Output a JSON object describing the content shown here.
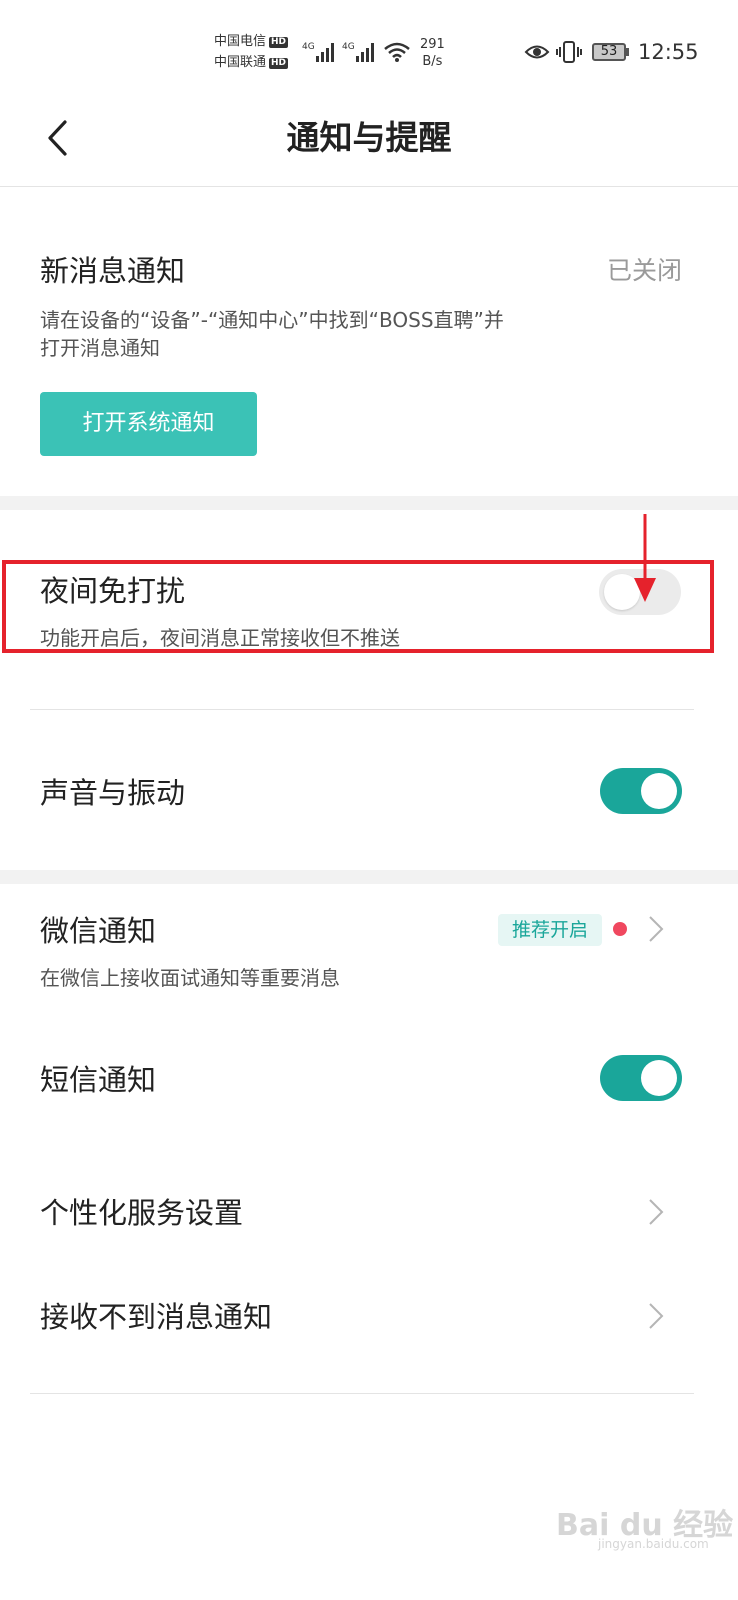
{
  "status_bar": {
    "carrier1": "中国电信",
    "carrier2": "中国联通",
    "hd_label": "HD",
    "net_type": "4G",
    "speed_value": "291",
    "speed_unit": "B/s",
    "battery": "53",
    "time": "12:55"
  },
  "header": {
    "title": "通知与提醒"
  },
  "new_message": {
    "title": "新消息通知",
    "status": "已关闭",
    "description": "请在设备的“设备”-“通知中心”中找到“BOSS直聘”并打开消息通知",
    "button_label": "打开系统通知"
  },
  "night_dnd": {
    "title": "夜间免打扰",
    "description": "功能开启后，夜间消息正常接收但不推送",
    "enabled": false
  },
  "sound_vibration": {
    "title": "声音与振动",
    "enabled": true
  },
  "wechat": {
    "title": "微信通知",
    "badge": "推荐开启",
    "description": "在微信上接收面试通知等重要消息"
  },
  "sms": {
    "title": "短信通知",
    "enabled": true
  },
  "personalized": {
    "title": "个性化服务设置"
  },
  "not_receiving": {
    "title": "接收不到消息通知"
  },
  "watermark": {
    "brand": "Bai du 经验",
    "url": "jingyan.baidu.com"
  },
  "colors": {
    "accent": "#1aa69a",
    "button": "#3bc2b6",
    "highlight_border": "#e5222c",
    "dot": "#f0485f"
  }
}
